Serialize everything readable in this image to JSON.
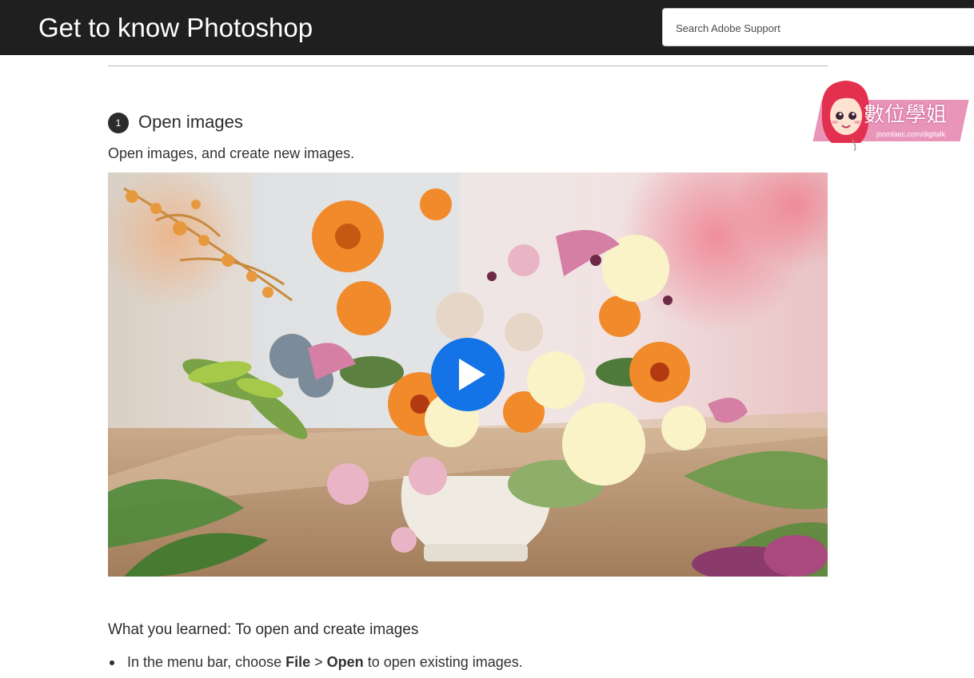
{
  "header": {
    "title": "Get to know Photoshop",
    "search_placeholder": "Search Adobe Support"
  },
  "step": {
    "number": "1",
    "title": "Open images",
    "description": "Open images, and create new images."
  },
  "video": {
    "thumbnail": "flower-arrangement-photo",
    "play_icon": "play-icon",
    "play_color": "#1473e6"
  },
  "learned": {
    "heading": "What you learned: To open and create images",
    "items": [
      {
        "pre": "In the menu bar, choose ",
        "bold1": "File",
        "sep": " > ",
        "bold2": "Open",
        "post": " to open existing images."
      }
    ]
  },
  "watermark": {
    "text": "數位學姐",
    "url": "joomlaec.com/digitalk"
  },
  "colors": {
    "header_bg": "#1f1f1f",
    "accent": "#1473e6"
  }
}
